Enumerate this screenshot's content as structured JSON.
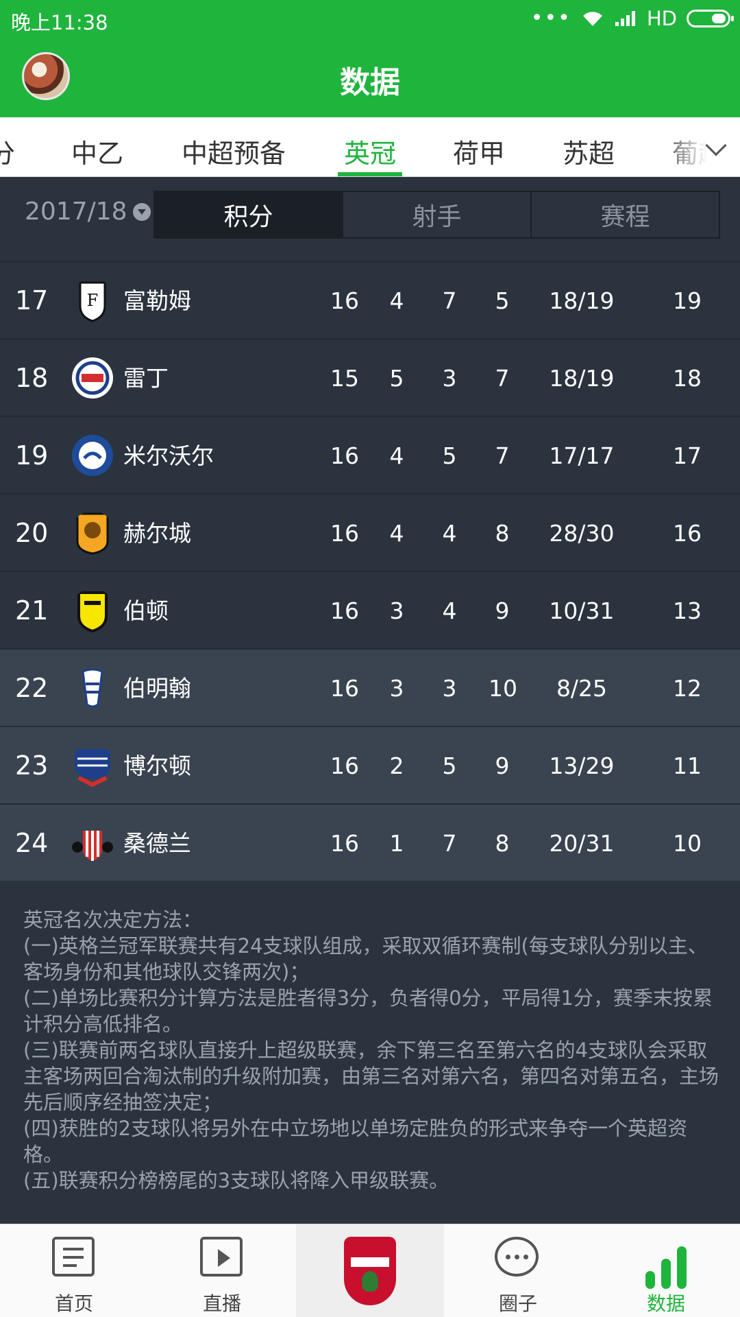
{
  "status_bar": {
    "time": "晚上11:38",
    "network": "HD"
  },
  "app_bar": {
    "title": "数据"
  },
  "league_tabs": {
    "items": [
      "分",
      "中乙",
      "中超预备",
      "英冠",
      "荷甲",
      "苏超",
      "葡超"
    ],
    "active": "英冠"
  },
  "sub_header": {
    "season": "2017/18",
    "segments": [
      "积分",
      "射手",
      "赛程"
    ],
    "active_segment": "积分"
  },
  "standings": [
    {
      "rank": "17",
      "team": "富勒姆",
      "played": "16",
      "won": "4",
      "drawn": "7",
      "lost": "5",
      "goals": "18/19",
      "points": "19",
      "crest_color": "#ffffff",
      "crest_accent": "#111111"
    },
    {
      "rank": "18",
      "team": "雷丁",
      "played": "15",
      "won": "5",
      "drawn": "3",
      "lost": "7",
      "goals": "18/19",
      "points": "18",
      "crest_color": "#ffffff",
      "crest_accent": "#d32f2f"
    },
    {
      "rank": "19",
      "team": "米尔沃尔",
      "played": "16",
      "won": "4",
      "drawn": "5",
      "lost": "7",
      "goals": "17/17",
      "points": "17",
      "crest_color": "#1e4b9a",
      "crest_accent": "#ffffff"
    },
    {
      "rank": "20",
      "team": "赫尔城",
      "played": "16",
      "won": "4",
      "drawn": "4",
      "lost": "8",
      "goals": "28/30",
      "points": "16",
      "crest_color": "#f5a623",
      "crest_accent": "#111111"
    },
    {
      "rank": "21",
      "team": "伯顿",
      "played": "16",
      "won": "3",
      "drawn": "4",
      "lost": "9",
      "goals": "10/31",
      "points": "13",
      "crest_color": "#f7e600",
      "crest_accent": "#111111"
    },
    {
      "rank": "22",
      "team": "伯明翰",
      "played": "16",
      "won": "3",
      "drawn": "3",
      "lost": "10",
      "goals": "8/25",
      "points": "12",
      "crest_color": "#ffffff",
      "crest_accent": "#1e3f8a"
    },
    {
      "rank": "23",
      "team": "博尔顿",
      "played": "16",
      "won": "2",
      "drawn": "5",
      "lost": "9",
      "goals": "13/29",
      "points": "11",
      "crest_color": "#1e3f8a",
      "crest_accent": "#d32f2f"
    },
    {
      "rank": "24",
      "team": "桑德兰",
      "played": "16",
      "won": "1",
      "drawn": "7",
      "lost": "8",
      "goals": "20/31",
      "points": "10",
      "crest_color": "#d32f2f",
      "crest_accent": "#ffffff"
    }
  ],
  "rules": {
    "heading": "英冠名次决定方法：",
    "lines": [
      "(一)英格兰冠军联赛共有24支球队组成，采取双循环赛制(每支球队分别以主、客场身份和其他球队交锋两次)；",
      "(二)单场比赛积分计算方法是胜者得3分，负者得0分，平局得1分，赛季末按累计积分高低排名。",
      "(三)联赛前两名球队直接升上超级联赛，余下第三名至第六名的4支球队会采取主客场两回合淘汰制的升级附加赛，由第三名对第六名，第四名对第五名，主场先后顺序经抽签决定；",
      "(四)获胜的2支球队将另外在中立场地以单场定胜负的形式来争夺一个英超资格。",
      "(五)联赛积分榜榜尾的3支球队将降入甲级联赛。"
    ]
  },
  "bottom_nav": {
    "items": [
      "首页",
      "直播",
      "",
      "圈子",
      "数据"
    ],
    "active": "数据"
  },
  "colors": {
    "brand": "#1fb43c",
    "background": "#2b333e",
    "highlight_row": "#3a4450"
  }
}
